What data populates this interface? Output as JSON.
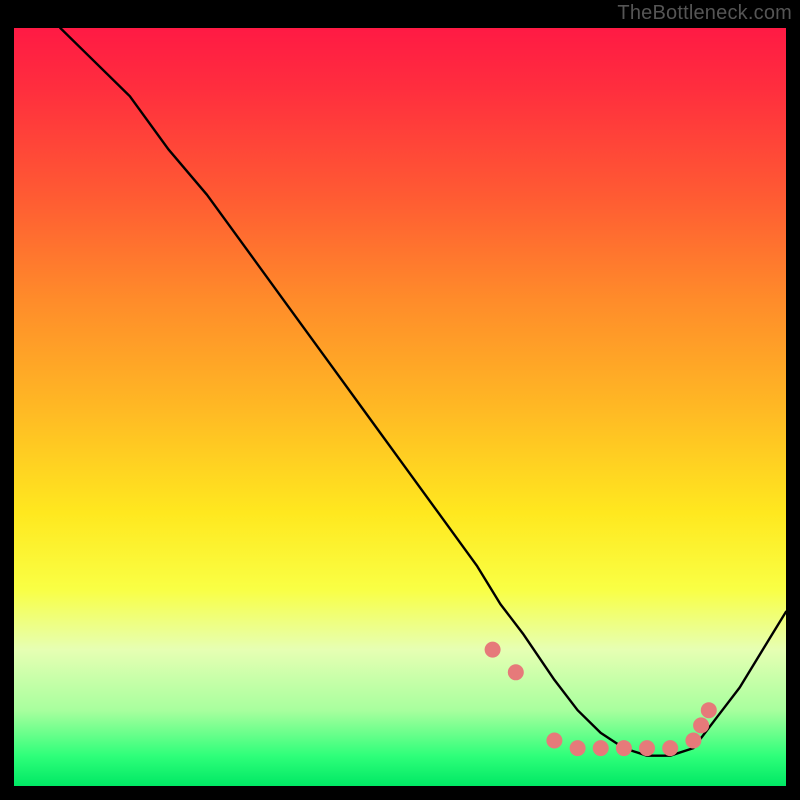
{
  "attribution": "TheBottleneck.com",
  "chart_data": {
    "type": "line",
    "title": "",
    "xlabel": "",
    "ylabel": "",
    "xlim": [
      0,
      100
    ],
    "ylim": [
      0,
      100
    ],
    "series": [
      {
        "name": "curve",
        "x": [
          6,
          10,
          15,
          20,
          25,
          30,
          35,
          40,
          45,
          50,
          55,
          60,
          63,
          66,
          70,
          73,
          76,
          79,
          82,
          85,
          88,
          91,
          94,
          97,
          100
        ],
        "values": [
          100,
          96,
          91,
          84,
          78,
          71,
          64,
          57,
          50,
          43,
          36,
          29,
          24,
          20,
          14,
          10,
          7,
          5,
          4,
          4,
          5,
          9,
          13,
          18,
          23
        ]
      }
    ],
    "markers": {
      "name": "bottom-dots",
      "x": [
        62,
        65,
        70,
        73,
        76,
        79,
        82,
        85,
        88,
        89,
        90
      ],
      "values": [
        18,
        15,
        6,
        5,
        5,
        5,
        5,
        5,
        6,
        8,
        10
      ]
    },
    "colors": {
      "curve": "#000000",
      "markers": "#e67a7a",
      "gradient_top": "#ff1a44",
      "gradient_bottom": "#00e864"
    }
  }
}
